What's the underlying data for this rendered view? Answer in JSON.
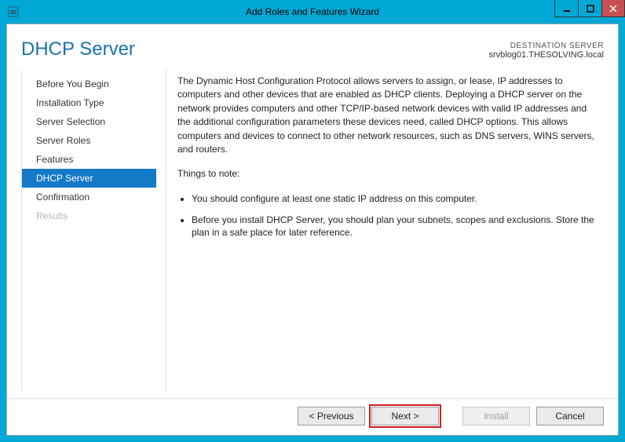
{
  "window": {
    "title": "Add Roles and Features Wizard"
  },
  "header": {
    "page_title": "DHCP Server",
    "destination_label": "DESTINATION SERVER",
    "destination_name": "srvblog01.THESOLVING.local"
  },
  "nav": {
    "items": [
      {
        "label": "Before You Begin",
        "state": "normal"
      },
      {
        "label": "Installation Type",
        "state": "normal"
      },
      {
        "label": "Server Selection",
        "state": "normal"
      },
      {
        "label": "Server Roles",
        "state": "normal"
      },
      {
        "label": "Features",
        "state": "normal"
      },
      {
        "label": "DHCP Server",
        "state": "selected"
      },
      {
        "label": "Confirmation",
        "state": "normal"
      },
      {
        "label": "Results",
        "state": "disabled"
      }
    ]
  },
  "content": {
    "intro": "The Dynamic Host Configuration Protocol allows servers to assign, or lease, IP addresses to computers and other devices that are enabled as DHCP clients. Deploying a DHCP server on the network provides computers and other TCP/IP-based network devices with valid IP addresses and the additional configuration parameters these devices need, called DHCP options. This allows computers and devices to connect to other network resources, such as DNS servers, WINS servers, and routers.",
    "note_heading": "Things to note:",
    "notes": [
      "You should configure at least one static IP address on this computer.",
      "Before you install DHCP Server, you should plan your subnets, scopes and exclusions. Store the plan in a safe place for later reference."
    ]
  },
  "footer": {
    "previous": "< Previous",
    "next": "Next >",
    "install": "Install",
    "cancel": "Cancel"
  }
}
